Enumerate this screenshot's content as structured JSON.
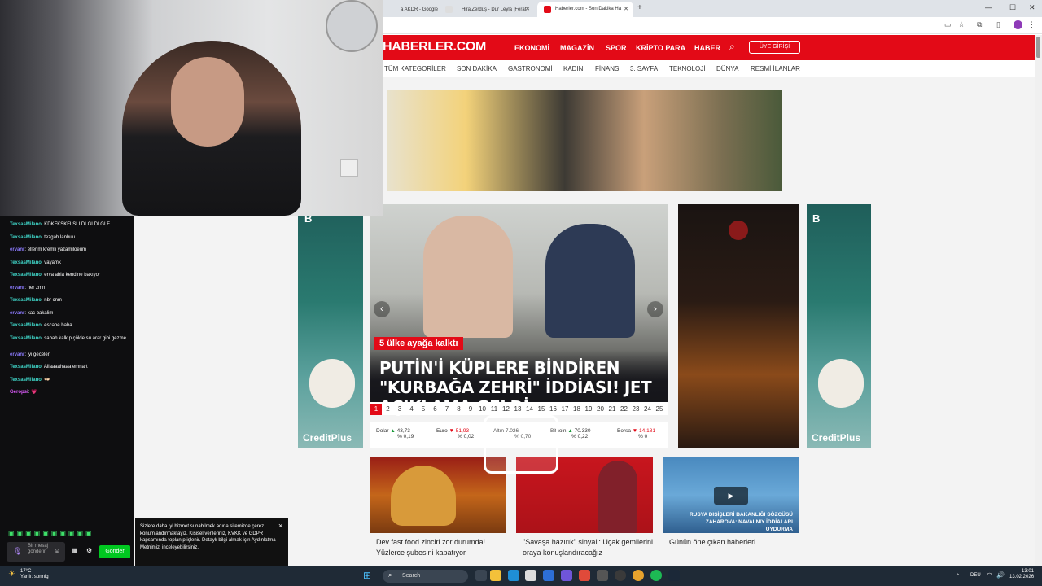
{
  "browser": {
    "tabs": [
      {
        "label": "a AKDR - Google ⋅"
      },
      {
        "label": "HiraiZerdüş - Dur Leyla [Ferat ⋅"
      },
      {
        "label": "Haberler.com - Son Dakika Ha"
      }
    ],
    "new_tab_icon": "+"
  },
  "site": {
    "logo": "HABERLER.COM",
    "nav": [
      "EKONOMİ",
      "MAGAZİN",
      "SPOR",
      "KRİPTO PARA",
      "HABER"
    ],
    "login_label": "ÜYE GİRİŞİ",
    "categories": [
      "TÜM KATEGORİLER",
      "SON DAKİKA",
      "GASTRONOMİ",
      "KADIN",
      "FİNANS",
      "3. SAYFA",
      "TEKNOLOJİ",
      "DÜNYA",
      "RESMİ İLANLAR"
    ],
    "slider": {
      "kicker": "5 ülke ayağa kalktı",
      "headline": "PUTİN'İ KÜPLERE BİNDİREN \"KURBAĞA ZEHRİ\" İDDİASI! JET AÇIKLAMA GELDİ",
      "pages": [
        "1",
        "2",
        "3",
        "4",
        "5",
        "6",
        "7",
        "8",
        "9",
        "10",
        "11",
        "12",
        "13",
        "14",
        "15",
        "16",
        "17",
        "18",
        "19",
        "20",
        "21",
        "22",
        "23",
        "24",
        "25"
      ],
      "active_page": "1"
    },
    "markets": [
      {
        "name": "Dolar",
        "value": "43,73",
        "change": "% 0,19"
      },
      {
        "name": "Euro",
        "value": "51,93",
        "change": "% 0,02"
      },
      {
        "name": "Altın",
        "value": "7.026",
        "change": "% 0,70"
      },
      {
        "name": "Bitcoin",
        "value": "70.330",
        "change": "% 0,22"
      },
      {
        "name": "Borsa",
        "value": "14.181",
        "change": "% 0"
      }
    ],
    "ads": {
      "side_letter": "B",
      "brand": "CreditPlus"
    },
    "cards": [
      {
        "title": "Dev fast food zinciri zor durumda! Yüzlerce şubesini kapatıyor"
      },
      {
        "title": "\"Savaşa hazırık\" sinyali: Uçak gemilerini oraya konuşlandıracağız"
      },
      {
        "title": "Günün öne çıkan haberleri",
        "caption": "RUSYA DIŞİŞLERİ BAKANLIĞI SÖZCÜSÜ ZAHAROVA: NAVALNIY İDDİALARI UYDURMA"
      }
    ]
  },
  "chat": {
    "messages": [
      {
        "user": "TexsasMilano",
        "text": "KDKFKSKFLSLLDLGLDLGLF",
        "color": "#3fd3c6"
      },
      {
        "user": "TexsasMilano",
        "text": "tezgah lanbuu",
        "color": "#3fd3c6"
      },
      {
        "user": "ervanr",
        "text": "ellerim kremli yazamiloeum",
        "color": "#8c7bff"
      },
      {
        "user": "TexsasMilano",
        "text": "vayamk",
        "color": "#3fd3c6"
      },
      {
        "user": "TexsasMilano",
        "text": "erva abla kendine bakıyor",
        "color": "#3fd3c6"
      },
      {
        "user": "ervanr",
        "text": "her zmn",
        "color": "#8c7bff"
      },
      {
        "user": "TexsasMilano",
        "text": "nbr cnm",
        "color": "#3fd3c6"
      },
      {
        "user": "ervanr",
        "text": "kac bakalim",
        "color": "#8c7bff"
      },
      {
        "user": "TexsasMilano",
        "text": "escape baba",
        "color": "#3fd3c6"
      },
      {
        "user": "TexsasMilano",
        "text": "sabah kalkıp çölde su arar gibi gezme",
        "color": "#3fd3c6"
      },
      {
        "user": "ervanr",
        "text": "iyi geceler",
        "color": "#8c7bff"
      },
      {
        "user": "TexsasMilano",
        "text": "Allaaaahaaa emnart",
        "color": "#3fd3c6"
      },
      {
        "user": "TexsasMilano",
        "text": "👐🏻",
        "color": "#3fd3c6"
      },
      {
        "user": "Geropsi",
        "text": "💗",
        "color": "#e05cff"
      }
    ],
    "input_placeholder": "Bir mesaj gönderin",
    "send_label": "Gönder"
  },
  "cookie": {
    "text": "Sizlere daha iyi hizmet sunabilmek adına sitemizde çerez konumlandırmaktayız. Kişisel verileriniz, KVKK ve GDPR kapsamında toplanıp işlenir. Detaylı bilgi almak için Aydınlatma Metnimizi inceleyebilirsiniz.",
    "close": "×"
  },
  "overlay": {
    "label": "abc"
  },
  "taskbar": {
    "weather_temp": "17°C",
    "weather_desc": "Yarılı: sonnig",
    "search_label": "Search",
    "lang": "DEU",
    "time": "13:01",
    "date": "13.02.2026"
  }
}
